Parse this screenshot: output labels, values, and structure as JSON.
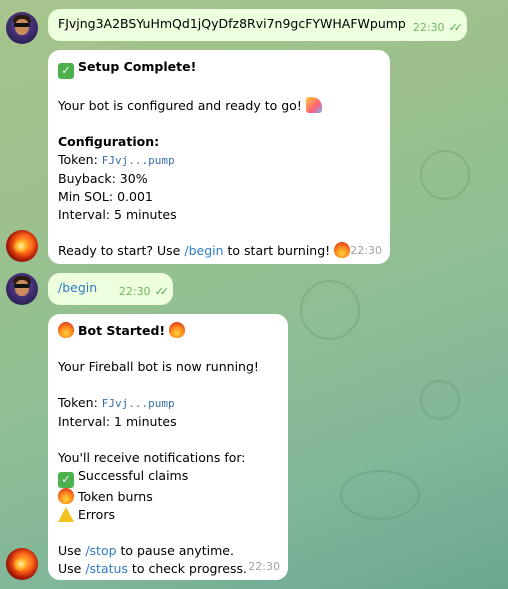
{
  "messages": [
    {
      "id": "msg1",
      "direction": "outgoing",
      "text": "FJvjng3A2BSYuHmQd1jQyDfz8Rvi7n9gcFYWHAFWpump",
      "time": "22:30"
    },
    {
      "id": "msg2",
      "direction": "incoming",
      "title": "Setup Complete!",
      "intro": "Your bot is configured and ready to go!",
      "config_heading": "Configuration:",
      "token_label": "Token:",
      "token_value": "FJvj...pump",
      "buyback": "Buyback: 30%",
      "min_sol": "Min SOL: 0.001",
      "interval": "Interval: 5 minutes",
      "ready_prefix": "Ready to start? Use ",
      "ready_cmd": "/begin",
      "ready_suffix": " to start burning!",
      "time": "22:30"
    },
    {
      "id": "msg3",
      "direction": "outgoing",
      "cmd": "/begin",
      "time": "22:30"
    },
    {
      "id": "msg4",
      "direction": "incoming",
      "title": "Bot Started!",
      "running": "Your Fireball bot is now running!",
      "token_label": "Token:",
      "token_value": "FJvj...pump",
      "interval": "Interval: 1 minutes",
      "notify_heading": "You'll receive notifications for:",
      "notify_claims": "Successful claims",
      "notify_burns": "Token burns",
      "notify_errors": "Errors",
      "stop_prefix": "Use ",
      "stop_cmd": "/stop",
      "stop_suffix": " to pause anytime.",
      "status_prefix": "Use ",
      "status_cmd": "/status",
      "status_suffix": " to check progress.",
      "time": "22:30"
    }
  ],
  "icons": {
    "check": "white-heavy-check-mark",
    "fire": "fire",
    "warning": "warning",
    "party": "party-popper",
    "read": "double-check-read-receipt"
  },
  "colors": {
    "outgoing_bubble": "#eeffde",
    "incoming_bubble": "#ffffff",
    "link": "#2f7ac7",
    "read_ticks": "#4fae4e"
  }
}
